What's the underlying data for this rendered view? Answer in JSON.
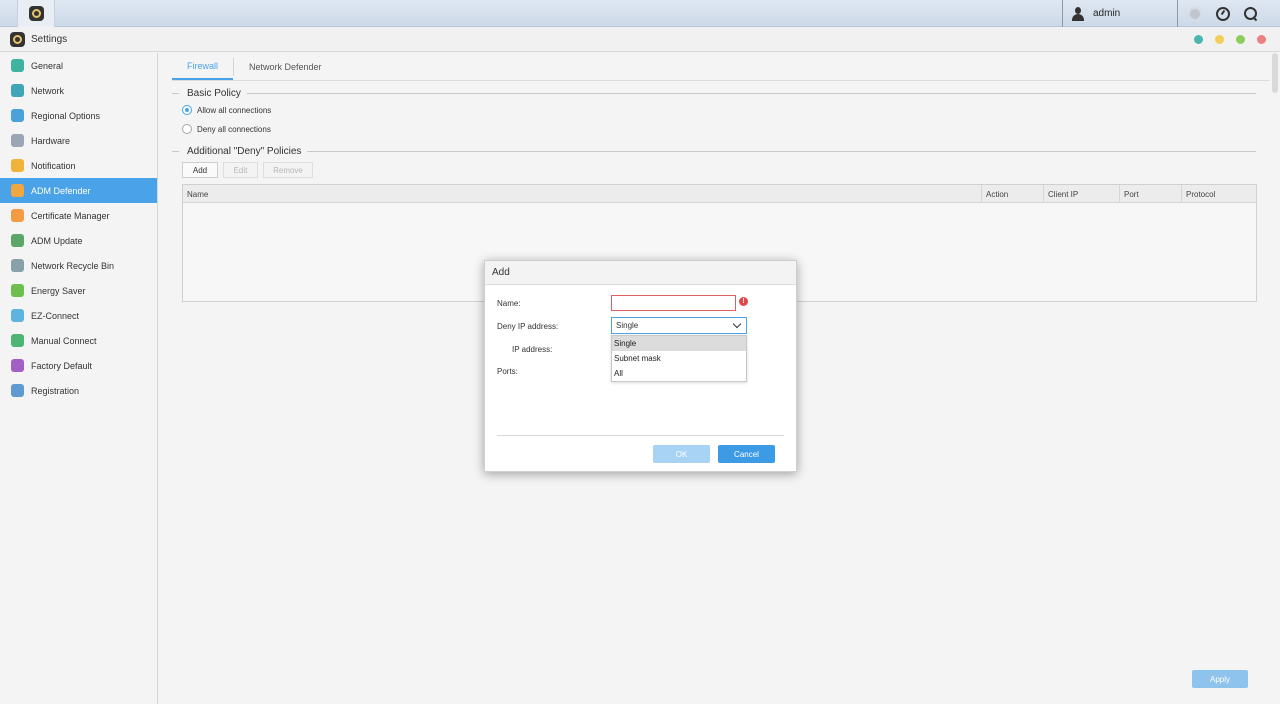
{
  "topbar": {
    "user_name": "admin",
    "icons": [
      "busy-indicator-icon",
      "dashboard-icon",
      "search-icon"
    ]
  },
  "window": {
    "title": "Settings",
    "controls": [
      {
        "name": "restore",
        "color": "#4ab6b0"
      },
      {
        "name": "minimize",
        "color": "#f1cd5a"
      },
      {
        "name": "maximize",
        "color": "#8ecd5c"
      },
      {
        "name": "close",
        "color": "#ef7f7f"
      }
    ]
  },
  "sidebar": {
    "items": [
      {
        "label": "General",
        "icon": "general-icon",
        "color": "#3fb2a0"
      },
      {
        "label": "Network",
        "icon": "globe-icon",
        "color": "#3fa6b9"
      },
      {
        "label": "Regional Options",
        "icon": "regional-icon",
        "color": "#4aa3d8"
      },
      {
        "label": "Hardware",
        "icon": "hardware-icon",
        "color": "#9aa6b5"
      },
      {
        "label": "Notification",
        "icon": "notification-icon",
        "color": "#f0b33a"
      },
      {
        "label": "ADM Defender",
        "icon": "shield-icon",
        "color": "#f2a640"
      },
      {
        "label": "Certificate Manager",
        "icon": "certificate-icon",
        "color": "#f39a45"
      },
      {
        "label": "ADM Update",
        "icon": "update-icon",
        "color": "#5aa769"
      },
      {
        "label": "Network Recycle Bin",
        "icon": "recycle-bin-icon",
        "color": "#88a0a8"
      },
      {
        "label": "Energy Saver",
        "icon": "energy-icon",
        "color": "#6cbf4f"
      },
      {
        "label": "EZ-Connect",
        "icon": "cloud-icon",
        "color": "#5eb4de"
      },
      {
        "label": "Manual Connect",
        "icon": "manual-connect-icon",
        "color": "#4fb577"
      },
      {
        "label": "Factory Default",
        "icon": "undo-icon",
        "color": "#a35fc4"
      },
      {
        "label": "Registration",
        "icon": "registration-icon",
        "color": "#5d9bd0"
      }
    ],
    "active_index": 5,
    "accent": "#4aa3e8"
  },
  "tabs": [
    "Firewall",
    "Network Defender"
  ],
  "basic_policy": {
    "title": "Basic Policy",
    "options": [
      "Allow all connections",
      "Deny all connections"
    ],
    "selected": 0
  },
  "deny_policies": {
    "title": "Additional \"Deny\" Policies",
    "buttons": {
      "add": "Add",
      "edit": "Edit",
      "remove": "Remove"
    },
    "columns": [
      "Name",
      "Action",
      "Client IP",
      "Port",
      "Protocol"
    ],
    "rows": []
  },
  "apply_label": "Apply",
  "dialog": {
    "title": "Add",
    "name_label": "Name:",
    "name_value": "",
    "deny_ip_label": "Deny IP address:",
    "deny_ip_value": "Single",
    "ip_label": "IP address:",
    "ports_label": "Ports:",
    "dropdown_options": [
      "Single",
      "Subnet mask",
      "All"
    ],
    "dropdown_selected": 0,
    "ok_label": "OK",
    "cancel_label": "Cancel"
  }
}
